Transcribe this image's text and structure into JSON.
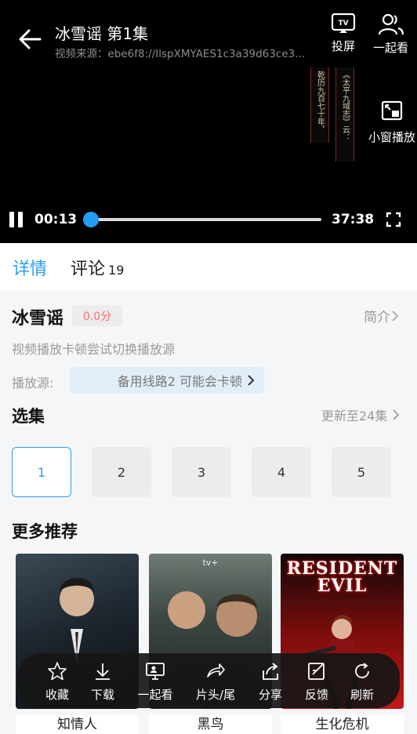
{
  "player": {
    "title": "冰雪谣  第1集",
    "source": "视频来源：ebe6f8://IlspXMYAES1c3a39d63ce3...",
    "cast_label": "投屏",
    "watch_together_label": "一起看",
    "pip_label": "小窗播放",
    "scroll_left": "乾历九百七十年，",
    "scroll_right": "《太平九域志》云：",
    "current_time": "00:13",
    "total_time": "37:38",
    "progress_fraction": 0.006
  },
  "tabs": {
    "detail": "详情",
    "comments": "评论",
    "comments_count": "19"
  },
  "detail": {
    "title": "冰雪谣",
    "score": "0.0分",
    "intro_label": "简介",
    "tip": "视频播放卡顿尝试切换播放源",
    "source_label": "播放源:",
    "source_value": "备用线路2 可能会卡顿"
  },
  "episodes": {
    "title": "选集",
    "update_label": "更新至24集",
    "items": [
      "1",
      "2",
      "3",
      "4",
      "5"
    ],
    "selected": "1"
  },
  "more": {
    "title": "更多推荐",
    "items": [
      {
        "title": "知情人"
      },
      {
        "title": "黑鸟",
        "poster_text": "tv+"
      },
      {
        "title": "生化危机",
        "poster_text": "RESIDENT EVIL"
      }
    ]
  },
  "action_bar": {
    "items": [
      {
        "label": "收藏",
        "icon": "star-icon"
      },
      {
        "label": "下载",
        "icon": "download-icon"
      },
      {
        "label": "一起看",
        "icon": "screen-share-icon"
      },
      {
        "label": "片头/尾",
        "icon": "skip-arrow-icon"
      },
      {
        "label": "分享",
        "icon": "share-icon"
      },
      {
        "label": "反馈",
        "icon": "feedback-icon"
      },
      {
        "label": "刷新",
        "icon": "refresh-icon"
      }
    ]
  },
  "colors": {
    "accent": "#2a9df4",
    "score": "#ff6b6b",
    "player_bg": "#000000"
  }
}
